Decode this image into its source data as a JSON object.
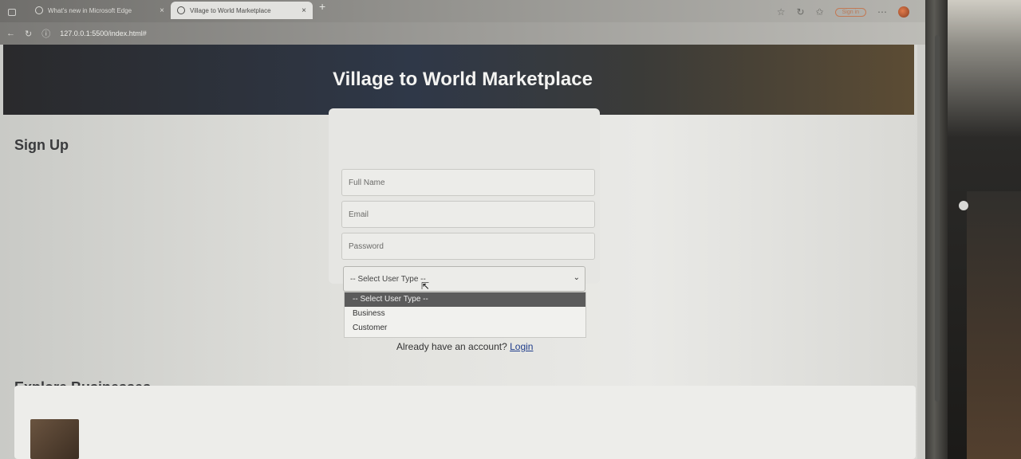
{
  "browser": {
    "tabs": [
      {
        "title": "What's new in Microsoft Edge",
        "close": "×"
      },
      {
        "title": "Village to World Marketplace",
        "close": "×"
      }
    ],
    "new_tab": "+",
    "url": "127.0.0.1:5500/index.html#",
    "sign_in": "Sign in"
  },
  "header": {
    "title": "Village to World Marketplace"
  },
  "signup": {
    "title": "Sign Up",
    "full_name_placeholder": "Full Name",
    "email_placeholder": "Email",
    "password_placeholder": "Password",
    "user_type_selected": "-- Select User Type --",
    "user_type_options": [
      "-- Select User Type --",
      "Business",
      "Customer"
    ],
    "login_prompt": "Already have an account?",
    "login_link": "Login"
  },
  "explore": {
    "title": "Explore Businesses"
  }
}
